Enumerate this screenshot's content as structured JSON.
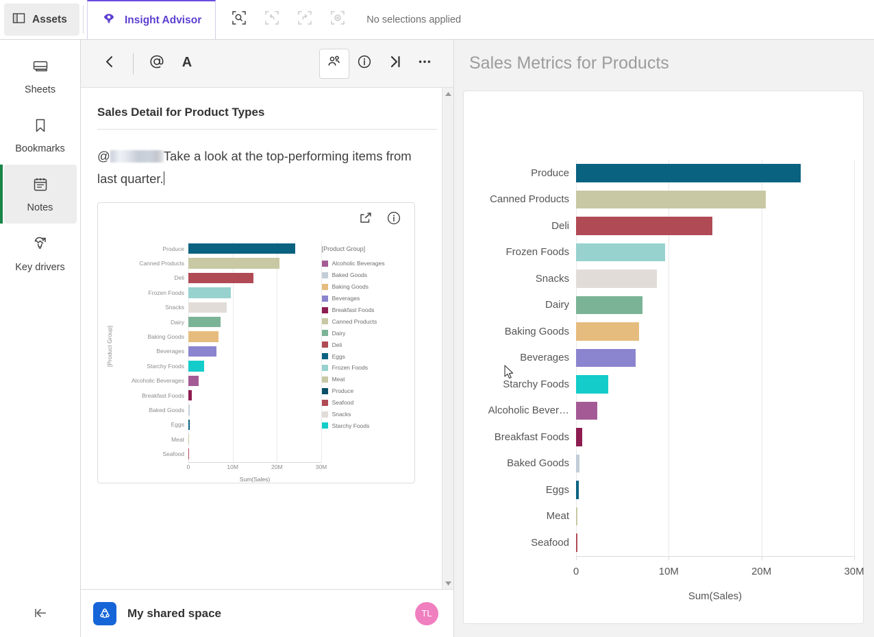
{
  "topbar": {
    "assets_label": "Assets",
    "assets_icon": "panel-layout-icon",
    "insight_advisor_label": "Insight Advisor",
    "insight_advisor_icon": "lightbulb-eye-icon",
    "selection_search_icon": "selection-search-icon",
    "selection_back_icon": "selection-step-back-icon",
    "selection_forward_icon": "selection-step-forward-icon",
    "selection_clear_icon": "selection-clear-icon",
    "no_selections_text": "No selections applied"
  },
  "rail": {
    "items": [
      {
        "label": "Sheets",
        "icon": "sheets-icon",
        "active": false
      },
      {
        "label": "Bookmarks",
        "icon": "bookmark-icon",
        "active": false
      },
      {
        "label": "Notes",
        "icon": "notes-icon",
        "active": true
      },
      {
        "label": "Key drivers",
        "icon": "key-drivers-icon",
        "active": false
      }
    ],
    "collapse_icon": "collapse-left-icon"
  },
  "notes_toolbar": {
    "back_icon": "chevron-left-icon",
    "mention_icon": "at-mention-icon",
    "format_icon": "text-format-icon",
    "people_icon": "share-people-icon",
    "info_icon": "info-circle-icon",
    "expand_icon": "expand-right-icon",
    "more_icon": "more-horizontal-icon"
  },
  "note": {
    "title": "Sales Detail for Product Types",
    "mention_prefix": "@",
    "mention_name": "",
    "body_text": "Take a look at the top-performing items from last quarter.",
    "embed_share_icon": "share-export-icon",
    "embed_info_icon": "info-circle-icon",
    "scroll_up_icon": "scroll-up-arrow",
    "scroll_down_icon": "scroll-down-arrow"
  },
  "notes_footer": {
    "space_icon": "shared-space-icon",
    "space_name": "My shared space",
    "avatar_initials": "TL",
    "avatar_color": "#f07fc0"
  },
  "right_pane": {
    "title": "Sales Metrics for Products"
  },
  "colors": {
    "accent_purple": "#5c3fd1",
    "active_green": "#1a8548",
    "space_blue": "#1665d8"
  },
  "chart_data": [
    {
      "id": "main-chart",
      "type": "bar",
      "orientation": "horizontal",
      "title": "Sales Metrics for Products",
      "xlabel": "Sum(Sales)",
      "ylabel": "",
      "xlim": [
        0,
        30000000
      ],
      "xticks": [
        0,
        10000000,
        20000000,
        30000000
      ],
      "xticklabels": [
        "0",
        "10M",
        "20M",
        "30M"
      ],
      "grid": true,
      "legend": false,
      "categories": [
        "Produce",
        "Canned Products",
        "Deli",
        "Frozen Foods",
        "Snacks",
        "Dairy",
        "Baking Goods",
        "Beverages",
        "Starchy Foods",
        "Alcoholic Bever…",
        "Breakfast Foods",
        "Baked Goods",
        "Eggs",
        "Meat",
        "Seafood"
      ],
      "values": [
        24200000,
        20500000,
        14700000,
        9600000,
        8700000,
        7200000,
        6800000,
        6400000,
        3500000,
        2300000,
        700000,
        350000,
        320000,
        30000,
        20000
      ],
      "bar_colors": [
        "#0a6281",
        "#c8c8a4",
        "#b04a55",
        "#97d2cf",
        "#e2dcd8",
        "#7bb396",
        "#e6bc7e",
        "#8b84ce",
        "#14ccc9",
        "#a45b95",
        "#8d1d50",
        "#c3cdd8",
        "#0a6281",
        "#c8c8a4",
        "#b04a55"
      ]
    },
    {
      "id": "embedded-chart",
      "type": "bar",
      "orientation": "horizontal",
      "title": "",
      "xlabel": "Sum(Sales)",
      "ylabel": "[Product Group]",
      "xlim": [
        0,
        30000000
      ],
      "xticks": [
        0,
        10000000,
        20000000,
        30000000
      ],
      "xticklabels": [
        "0",
        "10M",
        "20M",
        "30M"
      ],
      "grid": true,
      "legend": true,
      "legend_title": "[Product Group]",
      "legend_position": "right",
      "categories": [
        "Produce",
        "Canned Products",
        "Deli",
        "Frozen Foods",
        "Snacks",
        "Dairy",
        "Baking Goods",
        "Beverages",
        "Starchy Foods",
        "Alcoholic Beverages",
        "Breakfast Foods",
        "Baked Goods",
        "Eggs",
        "Meat",
        "Seafood"
      ],
      "values": [
        24200000,
        20500000,
        14700000,
        9600000,
        8700000,
        7200000,
        6800000,
        6400000,
        3500000,
        2300000,
        700000,
        350000,
        320000,
        30000,
        20000
      ],
      "bar_colors": [
        "#0a6281",
        "#c8c8a4",
        "#b04a55",
        "#97d2cf",
        "#e2dcd8",
        "#7bb396",
        "#e6bc7e",
        "#8b84ce",
        "#14ccc9",
        "#a45b95",
        "#8d1d50",
        "#c3cdd8",
        "#0a6281",
        "#c8c8a4",
        "#b04a55"
      ],
      "legend_entries": [
        {
          "label": "Alcoholic Beverages",
          "color": "#a45b95"
        },
        {
          "label": "Baked Goods",
          "color": "#c3cdd8"
        },
        {
          "label": "Baking Goods",
          "color": "#e6bc7e"
        },
        {
          "label": "Beverages",
          "color": "#8b84ce"
        },
        {
          "label": "Breakfast Foods",
          "color": "#8d1d50"
        },
        {
          "label": "Canned Products",
          "color": "#c8c8a4"
        },
        {
          "label": "Dairy",
          "color": "#7bb396"
        },
        {
          "label": "Deli",
          "color": "#b04a55"
        },
        {
          "label": "Eggs",
          "color": "#0a6281"
        },
        {
          "label": "Frozen Foods",
          "color": "#97d2cf"
        },
        {
          "label": "Meat",
          "color": "#c8c8a4"
        },
        {
          "label": "Produce",
          "color": "#0a4f68"
        },
        {
          "label": "Seafood",
          "color": "#b04a55"
        },
        {
          "label": "Snacks",
          "color": "#e2dcd8"
        },
        {
          "label": "Starchy Foods",
          "color": "#14ccc9"
        }
      ]
    }
  ]
}
